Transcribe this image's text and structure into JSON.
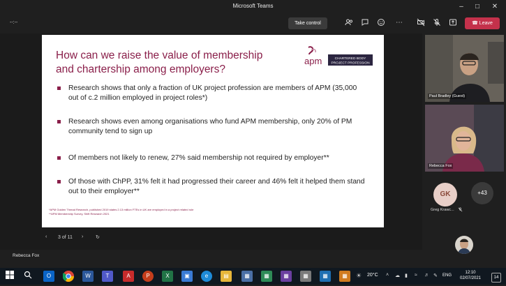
{
  "window": {
    "title": "Microsoft Teams"
  },
  "meeting": {
    "timer": "--:--",
    "take_control": "Take control",
    "leave": "Leave"
  },
  "slide": {
    "title": "How can we raise the value of membership and chartership among employers?",
    "logo_text": "apm",
    "logo_badge_line1": "CHARTERED BODY",
    "logo_badge_line2": "PROJECT PROFESSION",
    "bullets": [
      "Research shows that only a fraction of UK project profession are members of APM (35,000 out of c.2 million employed in project roles*)",
      "Research shows even among organisations who fund APM membership, only 20% of PM community tend to sign up",
      "Of members not likely to renew, 27% said membership not required by employer**",
      "Of those with ChPP, 31% felt it had progressed their career and 46% felt it helped them stand out to their employer**"
    ],
    "footnote1": "*APM Golden Thread Research, published 2019 states 2.13 million FTEs in UK are employed in a project related role",
    "footnote2": "**APM Membership Survey, Shift Research 2021",
    "page_indicator": "3 of 11"
  },
  "presenter": {
    "name": "Rebecca Fox"
  },
  "participants": {
    "tile1_name": "Paul Bradley (Guest)",
    "tile2_name": "Rebecca Fox",
    "gk_initials": "GK",
    "gk_name": "Greg Krawc...",
    "more": "+43"
  },
  "taskbar": {
    "temperature": "20°C",
    "language": "ENG",
    "time": "12:10",
    "date": "02/07/2021",
    "notifications": "14"
  },
  "colors": {
    "accent": "#8a1f4a",
    "leave": "#c4314b",
    "speaker_outline": "#7b83eb"
  }
}
